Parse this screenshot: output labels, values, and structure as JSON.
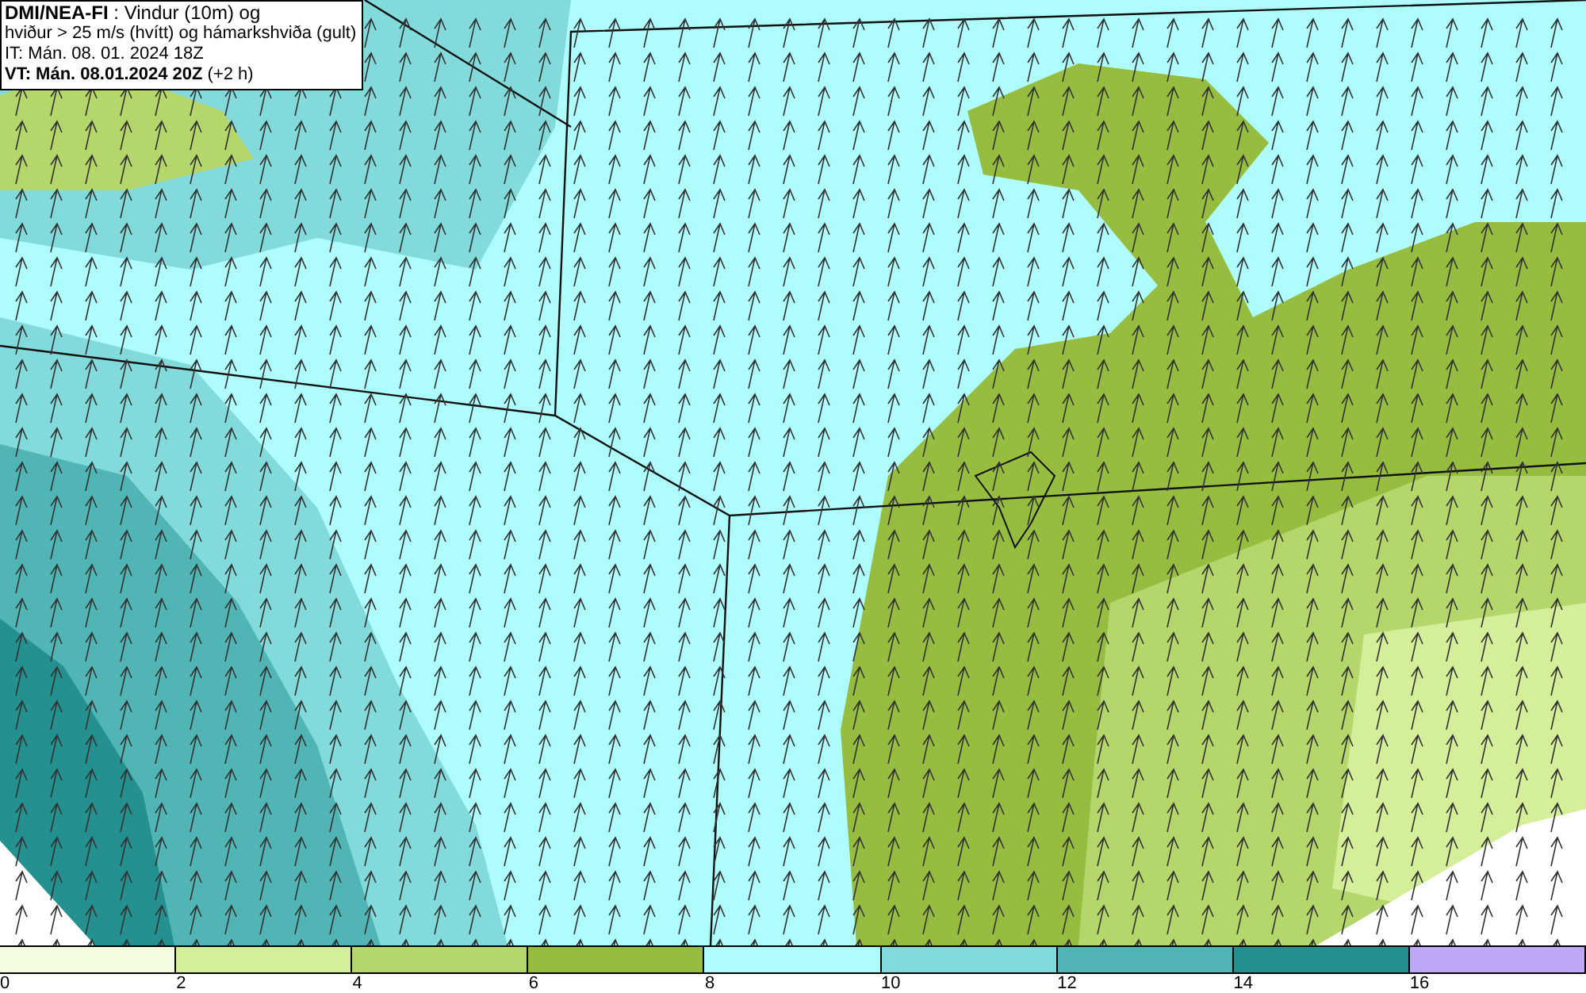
{
  "title_box": {
    "lines": [
      "**DMI/NEA-FI** : Vindur (10m) og",
      "hviður > 25 m/s (hvítt) og hámarkshviða (gult)",
      "IT: Mán. 08. 01. 2024 18Z",
      "**VT: Mán. 08.01.2024 20Z** (+2 h)"
    ]
  },
  "legend": {
    "bins": [
      {
        "color": "#f4fde0"
      },
      {
        "color": "#d4ee9a"
      },
      {
        "color": "#b5d66a"
      },
      {
        "color": "#97bd40"
      },
      {
        "color": "#aefcfc"
      },
      {
        "color": "#82dada"
      },
      {
        "color": "#52b5b5"
      },
      {
        "color": "#259090"
      },
      {
        "color": "#c0a8f8"
      }
    ],
    "ticks": [
      "0",
      "2",
      "4",
      "6",
      "8",
      "10",
      "12",
      "14",
      "16"
    ]
  }
}
